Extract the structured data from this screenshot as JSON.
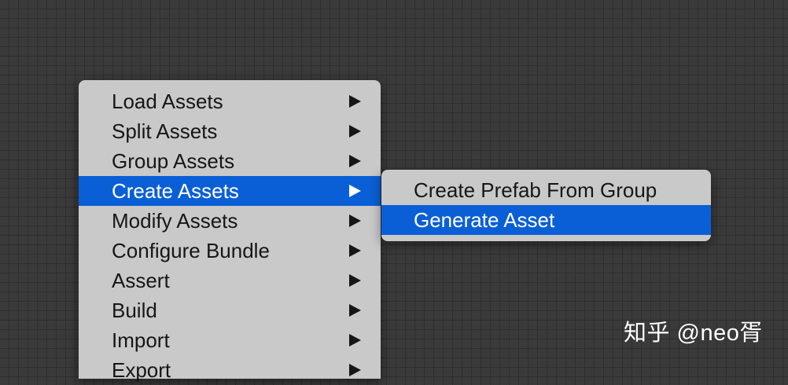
{
  "context_menu": {
    "items": [
      {
        "label": "Load Assets",
        "has_submenu": true,
        "selected": false
      },
      {
        "label": "Split Assets",
        "has_submenu": true,
        "selected": false
      },
      {
        "label": "Group Assets",
        "has_submenu": true,
        "selected": false
      },
      {
        "label": "Create Assets",
        "has_submenu": true,
        "selected": true
      },
      {
        "label": "Modify Assets",
        "has_submenu": true,
        "selected": false
      },
      {
        "label": "Configure Bundle",
        "has_submenu": true,
        "selected": false
      },
      {
        "label": "Assert",
        "has_submenu": true,
        "selected": false
      },
      {
        "label": "Build",
        "has_submenu": true,
        "selected": false
      },
      {
        "label": "Import",
        "has_submenu": true,
        "selected": false
      },
      {
        "label": "Export",
        "has_submenu": true,
        "selected": false
      }
    ],
    "submenu_arrow_icon": "triangle-right-icon"
  },
  "submenu": {
    "parent": "Create Assets",
    "items": [
      {
        "label": "Create Prefab From Group",
        "selected": false
      },
      {
        "label": "Generate Asset",
        "selected": true
      }
    ]
  },
  "watermark": {
    "text": "知乎 @neo胥"
  },
  "colors": {
    "canvas_background": "#3a3a3a",
    "grid_line": "#2f2f2f",
    "menu_background": "#c9c9c9",
    "selection_highlight": "#0a5fd6",
    "menu_text": "#161616",
    "selected_text": "#ffffff"
  }
}
